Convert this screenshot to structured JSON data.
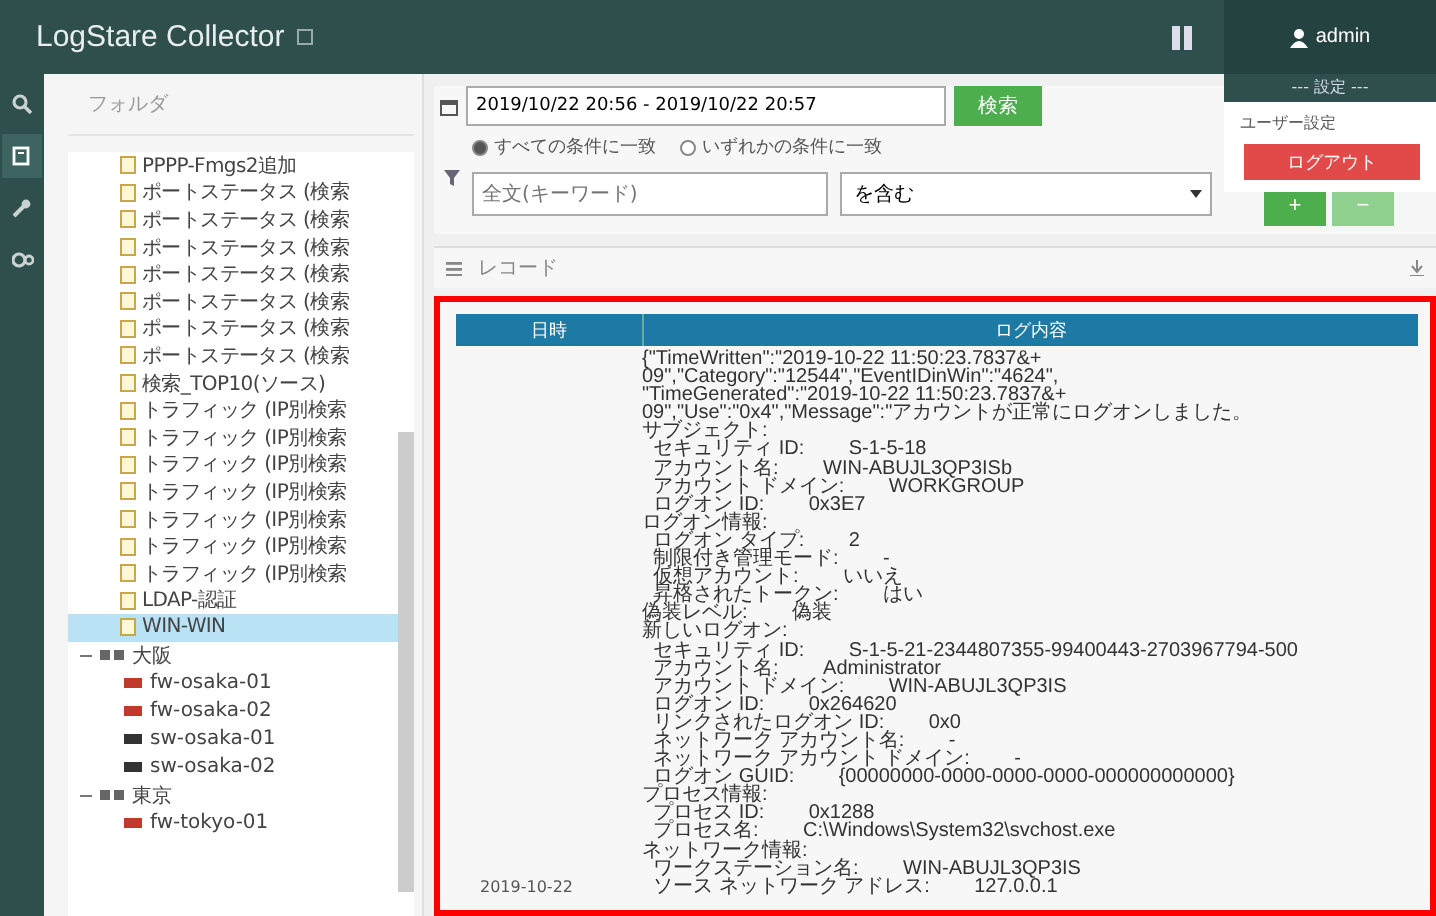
{
  "app": {
    "title": "LogStare Collector",
    "user": "admin"
  },
  "rail": [
    {
      "kind": "search",
      "selected": false
    },
    {
      "kind": "logs",
      "selected": true
    },
    {
      "kind": "wrench",
      "selected": false
    },
    {
      "kind": "gears",
      "selected": false
    }
  ],
  "tree": {
    "header": "フォルダ",
    "items": [
      {
        "label": "PPPP-Fmgs2追加",
        "kind": "log",
        "selected": false
      },
      {
        "label": "ポートステータス (検索",
        "kind": "log",
        "selected": false
      },
      {
        "label": "ポートステータス (検索",
        "kind": "log",
        "selected": false
      },
      {
        "label": "ポートステータス (検索",
        "kind": "log",
        "selected": false
      },
      {
        "label": "ポートステータス (検索",
        "kind": "log",
        "selected": false
      },
      {
        "label": "ポートステータス (検索",
        "kind": "log",
        "selected": false
      },
      {
        "label": "ポートステータス (検索",
        "kind": "log",
        "selected": false
      },
      {
        "label": "ポートステータス (検索",
        "kind": "log",
        "selected": false
      },
      {
        "label": "検索_TOP10(ソース)",
        "kind": "log",
        "selected": false
      },
      {
        "label": "トラフィック (IP別検索",
        "kind": "log",
        "selected": false
      },
      {
        "label": "トラフィック (IP別検索",
        "kind": "log",
        "selected": false
      },
      {
        "label": "トラフィック (IP別検索",
        "kind": "log",
        "selected": false
      },
      {
        "label": "トラフィック (IP別検索",
        "kind": "log",
        "selected": false
      },
      {
        "label": "トラフィック (IP別検索",
        "kind": "log",
        "selected": false
      },
      {
        "label": "トラフィック (IP別検索",
        "kind": "log",
        "selected": false
      },
      {
        "label": "トラフィック (IP別検索",
        "kind": "log",
        "selected": false
      },
      {
        "label": "LDAP-認証",
        "kind": "log",
        "selected": false
      },
      {
        "label": "WIN-WIN",
        "kind": "log",
        "selected": true
      }
    ],
    "groups": [
      {
        "label": "大阪",
        "expanded": true,
        "children": [
          {
            "label": "fw-osaka-01",
            "color": "#c0392b"
          },
          {
            "label": "fw-osaka-02",
            "color": "#c0392b"
          },
          {
            "label": "sw-osaka-01",
            "color": "#333333"
          },
          {
            "label": "sw-osaka-02",
            "color": "#333333"
          }
        ]
      },
      {
        "label": "東京",
        "expanded": true,
        "children": [
          {
            "label": "fw-tokyo-01",
            "color": "#c0392b"
          }
        ]
      }
    ]
  },
  "search": {
    "range": "2019/10/22 20:56 - 2019/10/22 20:57",
    "button": "検索",
    "match": [
      {
        "label": "すべての条件に一致",
        "selected": true
      },
      {
        "label": "いずれかの条件に一致",
        "selected": false
      }
    ],
    "keyword": {
      "placeholder": "全文(キーワード)"
    },
    "operator": "を含む",
    "add": "+",
    "remove": "−"
  },
  "user_menu": {
    "header": "--- 設定 ---",
    "item": "ユーザー設定",
    "logout": "ログアウト"
  },
  "records": {
    "title": "レコード",
    "columns": [
      "日時",
      "ログ内容"
    ],
    "date": "2019-10-22",
    "lines": [
      "{\"TimeWritten\":\"2019-10-22 11:50:23.7837&+",
      "09\",\"Category\":\"12544\",\"EventIDinWin\":\"4624\",",
      "\"TimeGenerated\":\"2019-10-22 11:50:23.7837&+",
      "09\",\"Use\":\"0x4\",\"Message\":\"アカウントが正常にログオンしました。",
      "サブジェクト:",
      "  セキュリティ ID:        S-1-5-18",
      "  アカウント名:        WIN-ABUJL3QP3ISb",
      "  アカウント ドメイン:        WORKGROUP",
      "  ログオン ID:        0x3E7",
      "ログオン情報:",
      "  ログオン タイプ:        2",
      "  制限付き管理モード:        -",
      "  仮想アカウント:        いいえ",
      "  昇格されたトークン:        はい",
      "偽装レベル:        偽装",
      "新しいログオン:",
      "  セキュリティ ID:        S-1-5-21-2344807355-99400443-2703967794-500",
      "  アカウント名:        Administrator",
      "  アカウント ドメイン:        WIN-ABUJL3QP3IS",
      "  ログオン ID:        0x264620",
      "  リンクされたログオン ID:        0x0",
      "  ネットワーク アカウント名:        -",
      "  ネットワーク アカウント ドメイン:        -",
      "  ログオン GUID:        {00000000-0000-0000-0000-000000000000}",
      "プロセス情報:",
      "  プロセス ID:        0x1288",
      "  プロセス名:        C:\\Windows\\System32\\svchost.exe",
      "ネットワーク情報:",
      "  ワークステーション名:        WIN-ABUJL3QP3IS",
      "  ソース ネットワーク アドレス:        127.0.0.1"
    ]
  }
}
